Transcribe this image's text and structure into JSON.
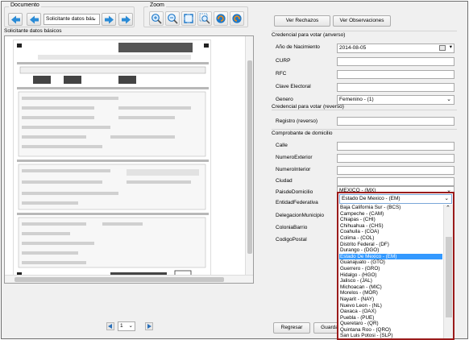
{
  "toolbar": {
    "documento_label": "Documento",
    "document_select_value": "Solicitante datos bás",
    "zoom_label": "Zoom"
  },
  "left_panel": {
    "title": "Solicitante datos básicos",
    "pager_value": "1"
  },
  "buttons": {
    "ver_rechazos": "Ver Rechazos",
    "ver_observaciones": "Ver Observaciones",
    "regresar": "Regresar",
    "guardar": "Guarda"
  },
  "credencial_anverso": {
    "title": "Credencial para votar (anverso)",
    "fields": [
      {
        "label": "Año de Nacimiento",
        "value": "2014-08-05"
      },
      {
        "label": "CURP",
        "value": ""
      },
      {
        "label": "RFC",
        "value": ""
      },
      {
        "label": "Clave Electoral",
        "value": ""
      },
      {
        "label": "Genero",
        "value": "Femenino - (1)"
      }
    ]
  },
  "credencial_reverso": {
    "title": "Credencial para votar (reverso)",
    "fields": [
      {
        "label": "Registro (reverso)",
        "value": ""
      }
    ]
  },
  "comprobante": {
    "title": "Comprobante de domicilio",
    "fields": [
      {
        "label": "Calle",
        "value": ""
      },
      {
        "label": "NumeroExterior",
        "value": ""
      },
      {
        "label": "NumeroInterior",
        "value": ""
      },
      {
        "label": "Ciudad",
        "value": ""
      },
      {
        "label": "PaisdeDomicilio",
        "value": "MEXICO - (MX)"
      },
      {
        "label": "EntidadFederativa",
        "value": "Estado De Mexico - (EM)"
      },
      {
        "label": "DelegacionMunicipio",
        "value": ""
      },
      {
        "label": "ColoniaBarrio",
        "value": ""
      },
      {
        "label": "CodigoPostal",
        "value": ""
      }
    ]
  },
  "entidad_dropdown": {
    "selected": "Estado De Mexico - (EM)",
    "options": [
      "Baja California Sur - (BCS)",
      "Campeche - (CAM)",
      "Chiapas - (CHI)",
      "Chihuahua - (CHS)",
      "Coahuila - (COA)",
      "Colima - (COL)",
      "Distrito Federal - (DF)",
      "Durango - (DGO)",
      "Estado De Mexico - (EM)",
      "Guanajuato - (GTO)",
      "Guerrero - (GRO)",
      "Hidalgo - (HGO)",
      "Jalisco - (JAL)",
      "Michoacan - (MIC)",
      "Morelos - (MOR)",
      "Nayarit - (NAY)",
      "Nuevo Leon - (NL)",
      "Oaxaca - (OAX)",
      "Puebla - (PUE)",
      "Queretaro - (QR)",
      "Quintana Roo - (QRO)",
      "San Luis Potosi - (SLP)"
    ],
    "highlighted_index": 8
  },
  "colors": {
    "accent": "#3399ff",
    "dropdown_border": "#9a1b1b",
    "nav_icon": "#2a8bd6",
    "zoom_icon_blue": "#1e78c8",
    "zoom_icon_orange": "#f08a14"
  }
}
